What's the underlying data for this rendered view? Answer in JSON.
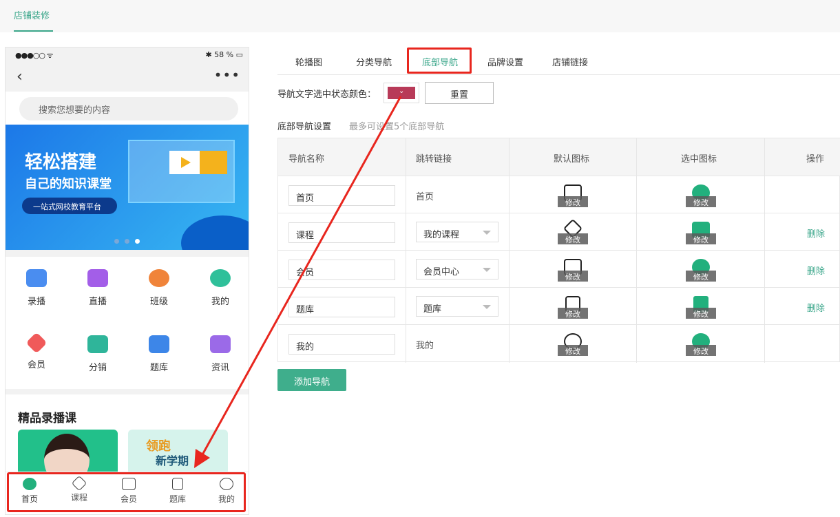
{
  "topbar": {
    "tab": "店铺装修"
  },
  "phone": {
    "status_left": "●●●○○ ᯤ",
    "status_right": "✱ 58 % ▭",
    "back": "‹",
    "more": "•••",
    "search_placeholder": "搜索您想要的内容",
    "banner": {
      "title": "轻松搭建",
      "subtitle": "自己的知识课堂",
      "pill": "一站式网校教育平台"
    },
    "grid": [
      {
        "label": "录播",
        "color": "#4a8df0"
      },
      {
        "label": "直播",
        "color": "#a35ee8"
      },
      {
        "label": "班级",
        "color": "#f0843a"
      },
      {
        "label": "我的",
        "color": "#2fc09a"
      },
      {
        "label": "会员",
        "color": "#f05a5a"
      },
      {
        "label": "分销",
        "color": "#2fb59a"
      },
      {
        "label": "题库",
        "color": "#3d86e8"
      },
      {
        "label": "资讯",
        "color": "#9b6ae8"
      }
    ],
    "section_title": "精品录播课",
    "card2_a": "领跑",
    "card2_b": "新学期",
    "tabbar": [
      "首页",
      "课程",
      "会员",
      "题库",
      "我的"
    ]
  },
  "tabs": [
    "轮播图",
    "分类导航",
    "底部导航",
    "品牌设置",
    "店铺链接"
  ],
  "active_tab": "底部导航",
  "color_setting": {
    "label": "导航文字选中状态颜色：",
    "color": "#b83a58",
    "chevron": "⌄",
    "reset": "重置"
  },
  "settings": {
    "title": "底部导航设置",
    "hint": "最多可设置5个底部导航"
  },
  "table": {
    "headers": [
      "导航名称",
      "跳转链接",
      "默认图标",
      "选中图标",
      "操作"
    ],
    "edit_label": "修改",
    "rows": [
      {
        "name": "首页",
        "link": "首页",
        "select": false,
        "delete": ""
      },
      {
        "name": "课程",
        "link": "我的课程",
        "select": true,
        "delete": "删除"
      },
      {
        "name": "会员",
        "link": "会员中心",
        "select": true,
        "delete": "删除"
      },
      {
        "name": "题库",
        "link": "题库",
        "select": true,
        "delete": "删除"
      },
      {
        "name": "我的",
        "link": "我的",
        "select": false,
        "delete": ""
      }
    ]
  },
  "add_button": "添加导航",
  "accent": "#3aa68a",
  "annotation_color": "#e8261e"
}
